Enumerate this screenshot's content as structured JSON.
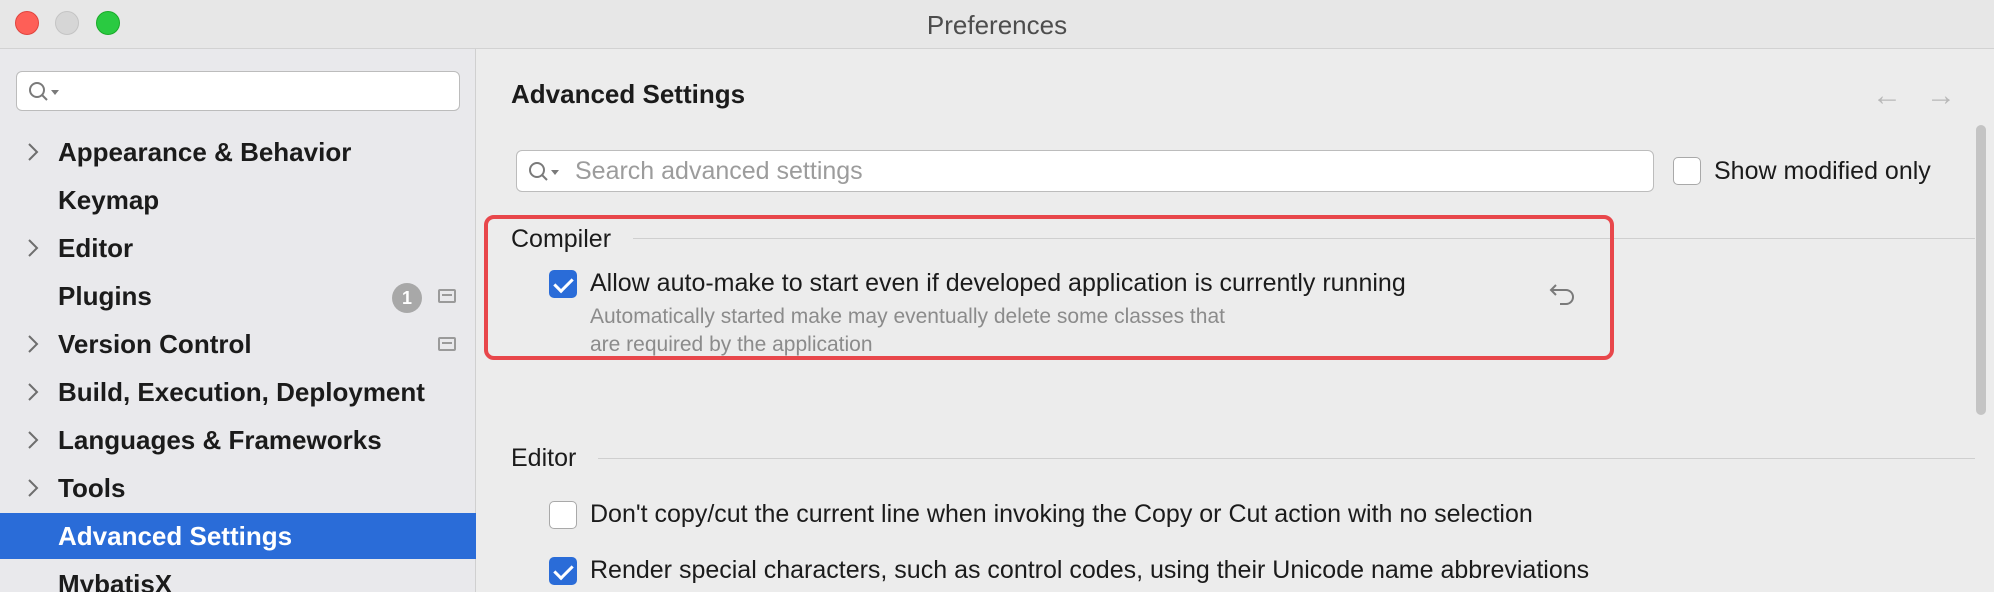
{
  "window": {
    "title": "Preferences"
  },
  "sidebar": {
    "search_placeholder": "",
    "items": [
      {
        "label": "Appearance & Behavior",
        "expandable": true
      },
      {
        "label": "Keymap",
        "expandable": false
      },
      {
        "label": "Editor",
        "expandable": true
      },
      {
        "label": "Plugins",
        "expandable": false,
        "badge": "1"
      },
      {
        "label": "Version Control",
        "expandable": true
      },
      {
        "label": "Build, Execution, Deployment",
        "expandable": true
      },
      {
        "label": "Languages & Frameworks",
        "expandable": true
      },
      {
        "label": "Tools",
        "expandable": true
      },
      {
        "label": "Advanced Settings",
        "expandable": false,
        "selected": true
      },
      {
        "label": "MybatisX",
        "expandable": false
      }
    ]
  },
  "main": {
    "title": "Advanced Settings",
    "search_placeholder": "Search advanced settings",
    "show_modified_label": "Show modified only",
    "show_modified_checked": false,
    "sections": {
      "compiler": {
        "title": "Compiler",
        "option_label": "Allow auto-make to start even if developed application is currently running",
        "option_checked": true,
        "description_line1": "Automatically started make may eventually delete some classes that",
        "description_line2": "are required by the application"
      },
      "editor": {
        "title": "Editor",
        "options": [
          {
            "label": "Don't copy/cut the current line when invoking the Copy or Cut action with no selection",
            "checked": false
          },
          {
            "label": "Render special characters, such as control codes, using their Unicode name abbreviations",
            "checked": true
          }
        ]
      }
    }
  },
  "colors": {
    "accent": "#2a6cd8",
    "highlight": "#e8474b"
  }
}
